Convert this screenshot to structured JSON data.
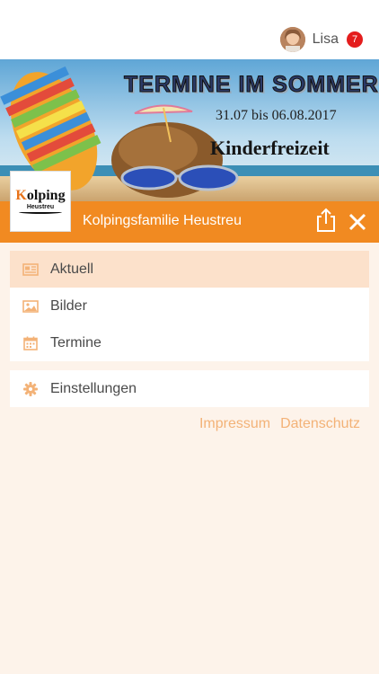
{
  "user": {
    "name": "Lisa",
    "notification_count": "7"
  },
  "banner": {
    "title": "TERMINE IM SOMMER",
    "dates": "31.07 bis 06.08.2017",
    "event": "Kinderfreizeit"
  },
  "logo": {
    "main": "olping",
    "initial": "K",
    "sub": "Heustreu"
  },
  "header": {
    "org_name": "Kolpingsfamilie Heustreu"
  },
  "menu": {
    "items": [
      {
        "label": "Aktuell",
        "icon": "newspaper-icon",
        "active": true
      },
      {
        "label": "Bilder",
        "icon": "image-icon",
        "active": false
      },
      {
        "label": "Termine",
        "icon": "calendar-icon",
        "active": false
      }
    ],
    "settings": {
      "label": "Einstellungen",
      "icon": "gear-icon"
    }
  },
  "footer": {
    "impressum": "Impressum",
    "datenschutz": "Datenschutz"
  },
  "colors": {
    "accent": "#f18a21",
    "background": "#fdf3ea",
    "active_item": "#fce1cb",
    "icon": "#f3b277",
    "badge": "#e41d1d"
  }
}
